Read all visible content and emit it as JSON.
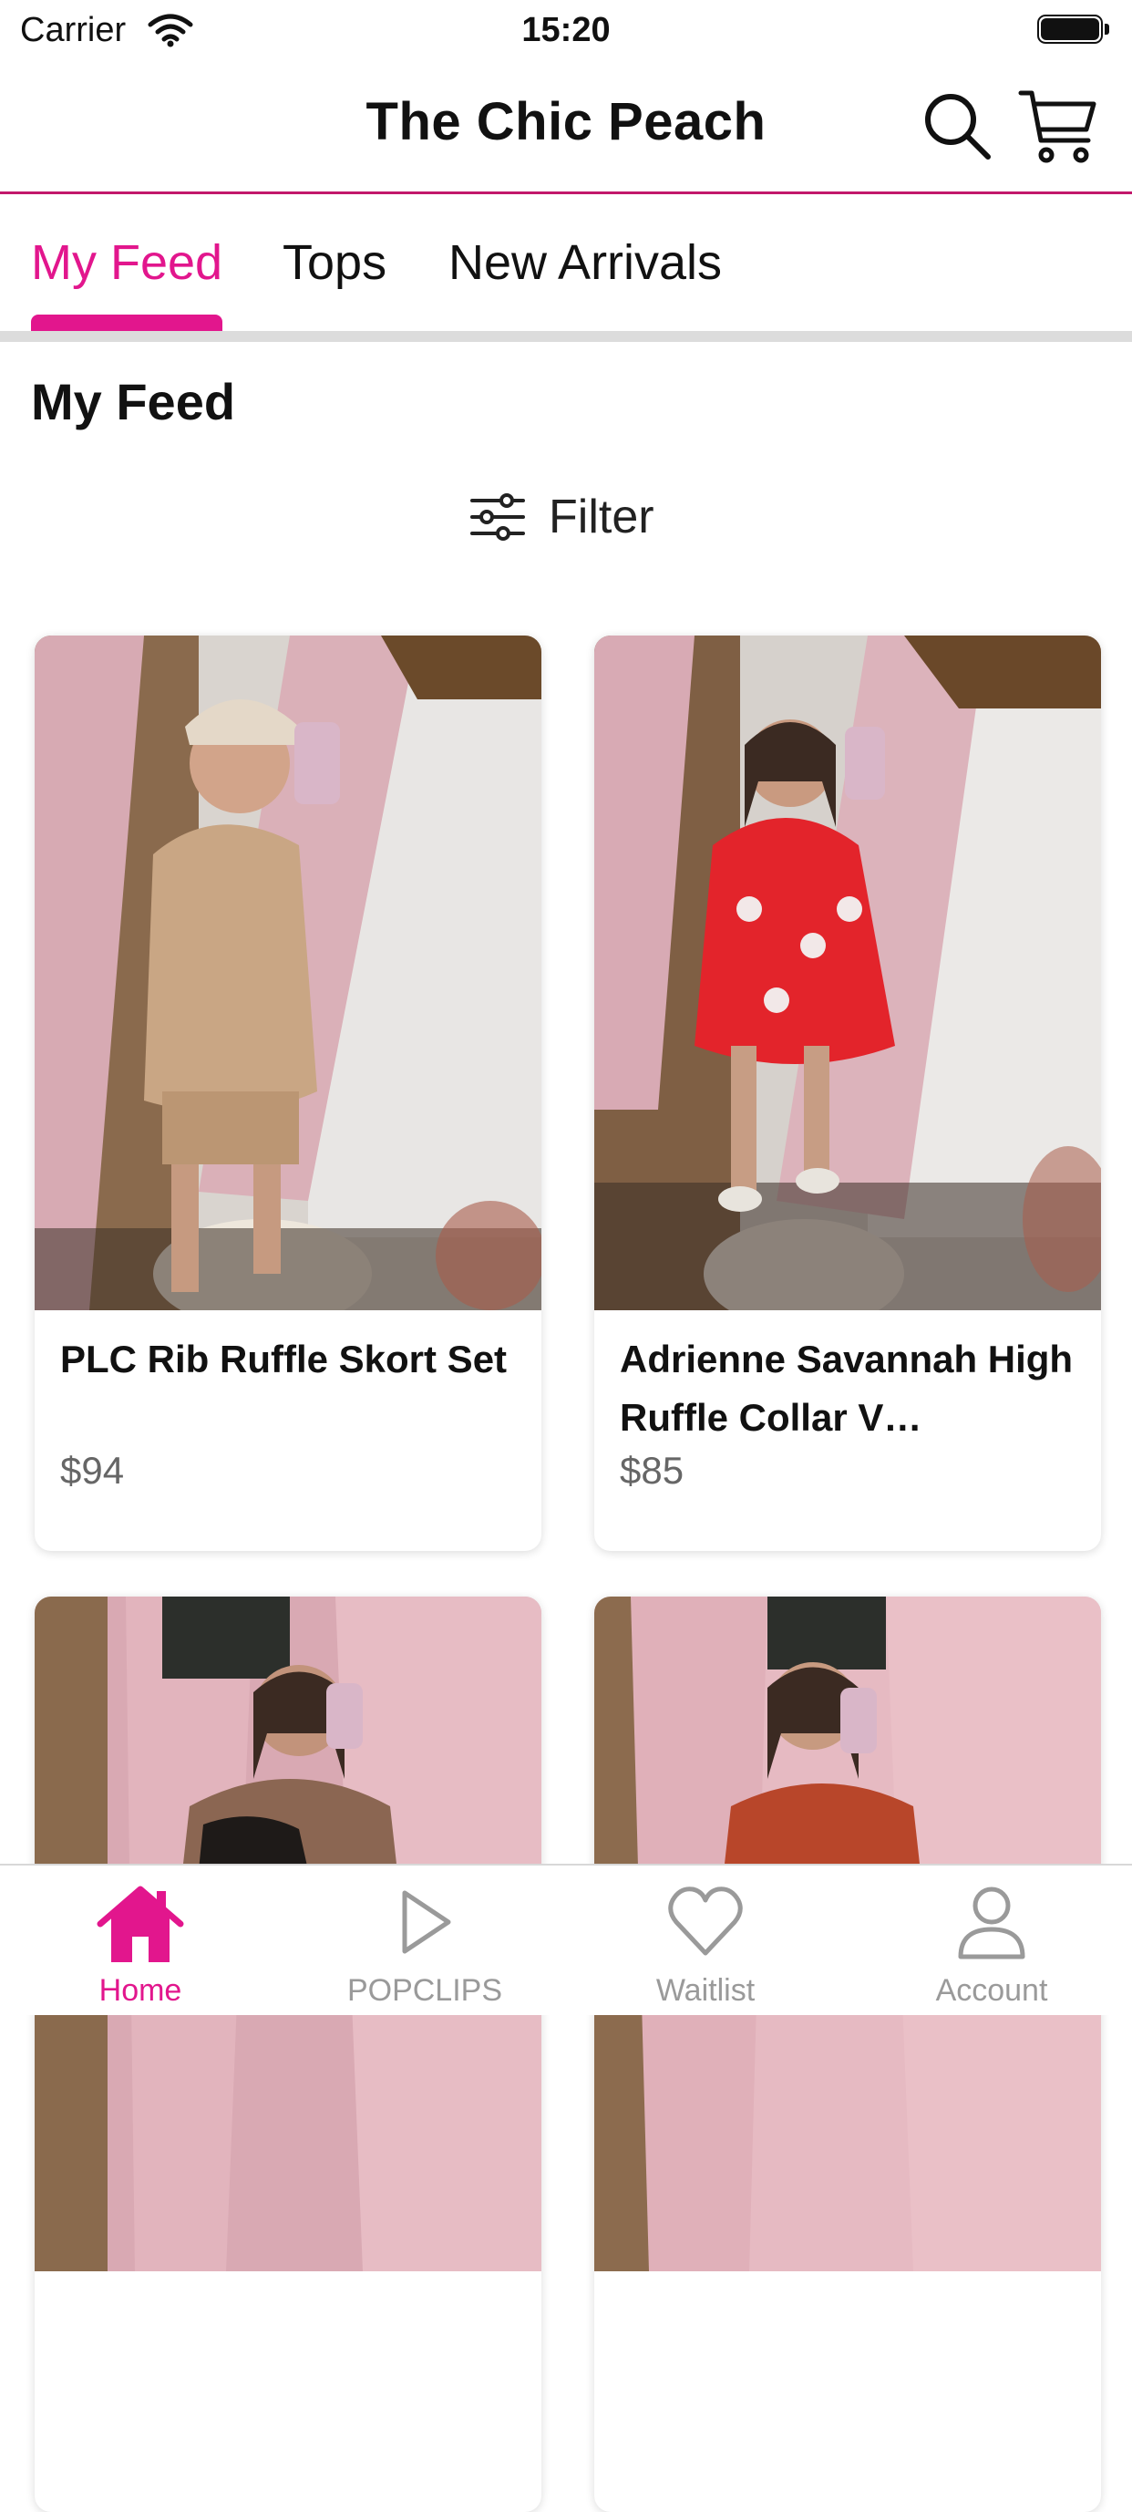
{
  "status_bar": {
    "carrier": "Carrier",
    "time": "15:20"
  },
  "header": {
    "title": "The Chic Peach"
  },
  "tabs": [
    {
      "label": "My Feed",
      "active": true
    },
    {
      "label": "Tops",
      "active": false
    },
    {
      "label": "New Arrivals",
      "active": false
    }
  ],
  "section": {
    "title": "My Feed",
    "filter_label": "Filter"
  },
  "products": [
    {
      "name": "PLC Rib Ruffle Skort Set",
      "price": "$94"
    },
    {
      "name": "Adrienne Savannah High Ruffle Collar V…",
      "price": "$85"
    },
    {
      "name": "",
      "price": ""
    },
    {
      "name": "",
      "price": ""
    }
  ],
  "tab_bar": [
    {
      "label": "Home",
      "icon": "home-icon",
      "active": true
    },
    {
      "label": "POPCLIPS",
      "icon": "play-icon",
      "active": false
    },
    {
      "label": "Waitlist",
      "icon": "heart-icon",
      "active": false
    },
    {
      "label": "Account",
      "icon": "person-icon",
      "active": false
    }
  ],
  "colors": {
    "accent": "#e2168d",
    "divider": "#c2186b",
    "inactive": "#9a9a9a"
  }
}
